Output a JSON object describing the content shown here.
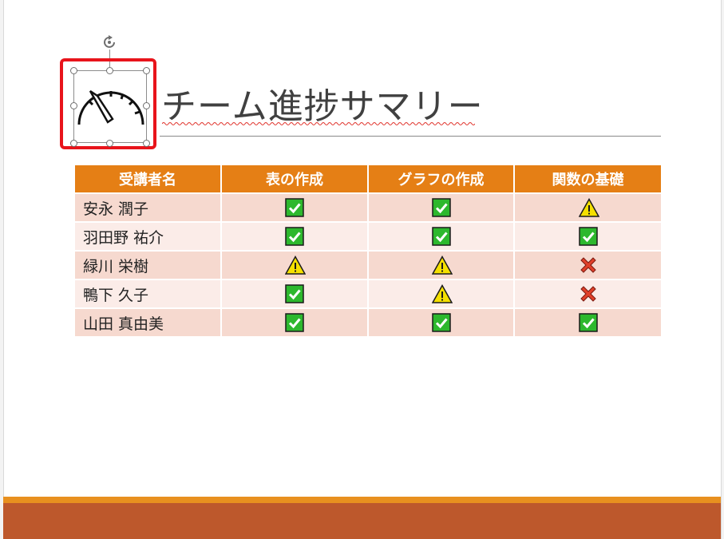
{
  "slide": {
    "title": "チーム進捗サマリー",
    "selected_icon": "speedometer-icon"
  },
  "table": {
    "headers": [
      "受講者名",
      "表の作成",
      "グラフの作成",
      "関数の基礎"
    ],
    "rows": [
      {
        "name": "安永 潤子",
        "statuses": [
          "check",
          "check",
          "warning"
        ]
      },
      {
        "name": "羽田野 祐介",
        "statuses": [
          "check",
          "check",
          "check"
        ]
      },
      {
        "name": "緑川 栄樹",
        "statuses": [
          "warning",
          "warning",
          "cross"
        ]
      },
      {
        "name": "鴨下 久子",
        "statuses": [
          "check",
          "warning",
          "cross"
        ]
      },
      {
        "name": "山田 真由美",
        "statuses": [
          "check",
          "check",
          "check"
        ]
      }
    ]
  },
  "colors": {
    "header_bg": "#e57f15",
    "row_odd": "#f6d9cf",
    "row_even": "#fbece8",
    "footer_bar": "#bd582c",
    "footer_line": "#e8901f",
    "selection_highlight": "#e8141b",
    "check": "#2db82d",
    "warning": "#f5e000",
    "cross": "#e0402a"
  }
}
